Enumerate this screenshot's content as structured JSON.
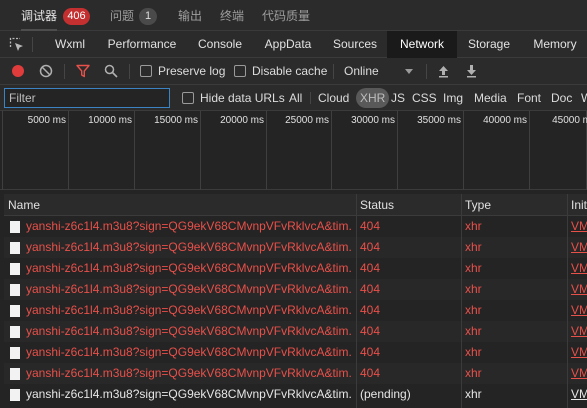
{
  "top_tabs": [
    {
      "label": "调试器",
      "badge": "406"
    },
    {
      "label": "问题",
      "badge": "1"
    },
    {
      "label": "输出"
    },
    {
      "label": "终端"
    },
    {
      "label": "代码质量"
    }
  ],
  "panel_tabs": [
    "Wxml",
    "Performance",
    "Console",
    "AppData",
    "Sources",
    "Network",
    "Storage",
    "Memory"
  ],
  "active_panel": "Network",
  "toolbar": {
    "preserve_log_label": "Preserve log",
    "disable_cache_label": "Disable cache",
    "throttle_value": "Online"
  },
  "filter": {
    "placeholder": "Filter",
    "hide_data_urls_label": "Hide data URLs",
    "types": [
      "All",
      "Cloud",
      "XHR",
      "JS",
      "CSS",
      "Img",
      "Media",
      "Font",
      "Doc",
      "W"
    ],
    "selected_type": "XHR"
  },
  "timeline_ticks": [
    "5000 ms",
    "10000 ms",
    "15000 ms",
    "20000 ms",
    "25000 ms",
    "30000 ms",
    "35000 ms",
    "40000 ms",
    "45000 ms"
  ],
  "table": {
    "columns": [
      "Name",
      "Status",
      "Type",
      "Init"
    ],
    "rows": [
      {
        "name": "yanshi-z6c1l4.m3u8?sign=QG9ekV68CMvnpVFvRklvcA&tim...",
        "status": "404",
        "type": "xhr",
        "initiator": "VM",
        "failed": true
      },
      {
        "name": "yanshi-z6c1l4.m3u8?sign=QG9ekV68CMvnpVFvRklvcA&tim...",
        "status": "404",
        "type": "xhr",
        "initiator": "VM",
        "failed": true
      },
      {
        "name": "yanshi-z6c1l4.m3u8?sign=QG9ekV68CMvnpVFvRklvcA&tim...",
        "status": "404",
        "type": "xhr",
        "initiator": "VM",
        "failed": true
      },
      {
        "name": "yanshi-z6c1l4.m3u8?sign=QG9ekV68CMvnpVFvRklvcA&tim...",
        "status": "404",
        "type": "xhr",
        "initiator": "VM",
        "failed": true
      },
      {
        "name": "yanshi-z6c1l4.m3u8?sign=QG9ekV68CMvnpVFvRklvcA&tim...",
        "status": "404",
        "type": "xhr",
        "initiator": "VM",
        "failed": true
      },
      {
        "name": "yanshi-z6c1l4.m3u8?sign=QG9ekV68CMvnpVFvRklvcA&tim...",
        "status": "404",
        "type": "xhr",
        "initiator": "VM",
        "failed": true
      },
      {
        "name": "yanshi-z6c1l4.m3u8?sign=QG9ekV68CMvnpVFvRklvcA&tim...",
        "status": "404",
        "type": "xhr",
        "initiator": "VM",
        "failed": true
      },
      {
        "name": "yanshi-z6c1l4.m3u8?sign=QG9ekV68CMvnpVFvRklvcA&tim...",
        "status": "404",
        "type": "xhr",
        "initiator": "VM",
        "failed": true
      },
      {
        "name": "yanshi-z6c1l4.m3u8?sign=QG9ekV68CMvnpVFvRklvcA&tim...",
        "status": "(pending)",
        "type": "xhr",
        "initiator": "VM",
        "failed": false
      }
    ]
  },
  "colors": {
    "error": "#e8504a",
    "record": "#e03c3c",
    "filter_funnel": "#e8504a",
    "accent_border": "#3c83c4"
  },
  "icons": [
    "inspect-icon",
    "record-icon",
    "clear-icon",
    "filter-icon",
    "search-icon",
    "import-icon",
    "export-icon",
    "file-icon"
  ]
}
